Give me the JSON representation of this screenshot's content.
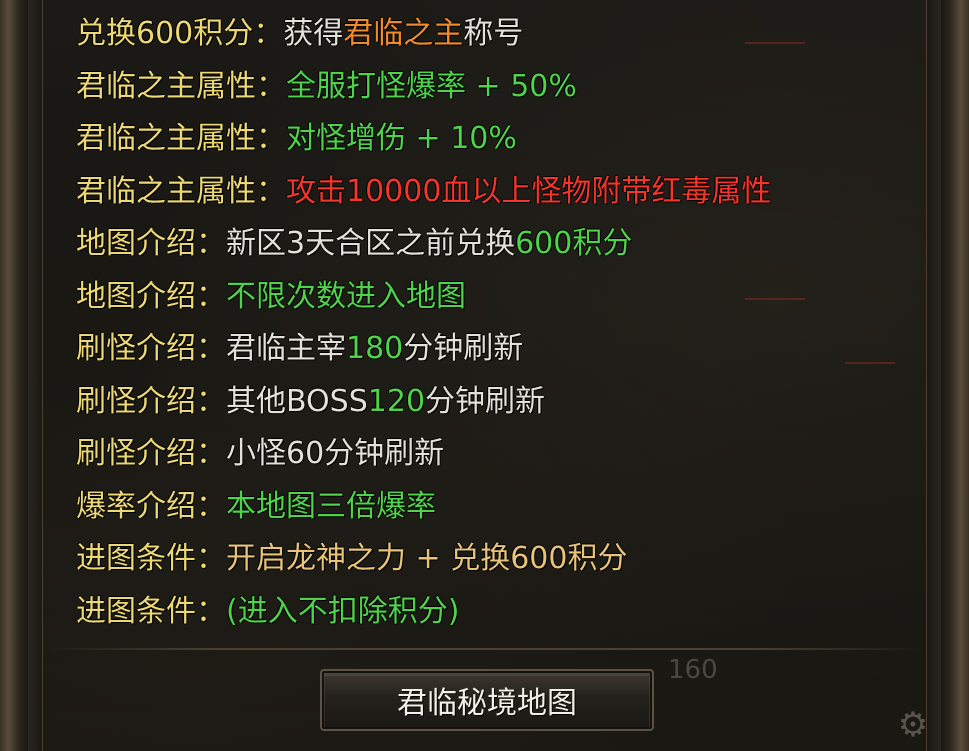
{
  "lines": [
    {
      "segments": [
        {
          "text": "兑换600积分：",
          "color": "yellow"
        },
        {
          "text": "获得",
          "color": "white"
        },
        {
          "text": "君临之主",
          "color": "orange"
        },
        {
          "text": "称号",
          "color": "white"
        }
      ]
    },
    {
      "segments": [
        {
          "text": "君临之主属性：",
          "color": "yellow"
        },
        {
          "text": "全服打怪爆率 + 50%",
          "color": "green"
        }
      ]
    },
    {
      "segments": [
        {
          "text": "君临之主属性：",
          "color": "yellow"
        },
        {
          "text": "对怪增伤 + 10%",
          "color": "green"
        }
      ]
    },
    {
      "segments": [
        {
          "text": "君临之主属性：",
          "color": "yellow"
        },
        {
          "text": "攻击10000血以上怪物附带红毒属性",
          "color": "red"
        }
      ]
    },
    {
      "segments": [
        {
          "text": "地图介绍：",
          "color": "yellow"
        },
        {
          "text": "新区3天合区之前兑换",
          "color": "white"
        },
        {
          "text": "600积分",
          "color": "green"
        }
      ]
    },
    {
      "segments": [
        {
          "text": "地图介绍：",
          "color": "yellow"
        },
        {
          "text": "不限次数进入地图",
          "color": "green"
        }
      ]
    },
    {
      "segments": [
        {
          "text": "刷怪介绍：",
          "color": "yellow"
        },
        {
          "text": "君临主宰",
          "color": "white"
        },
        {
          "text": "180",
          "color": "green"
        },
        {
          "text": "分钟刷新",
          "color": "white"
        }
      ]
    },
    {
      "segments": [
        {
          "text": "刷怪介绍：",
          "color": "yellow"
        },
        {
          "text": "其他BOSS",
          "color": "white"
        },
        {
          "text": "120",
          "color": "green"
        },
        {
          "text": "分钟刷新",
          "color": "white"
        }
      ]
    },
    {
      "segments": [
        {
          "text": "刷怪介绍：",
          "color": "yellow"
        },
        {
          "text": "小怪60分钟刷新",
          "color": "white"
        }
      ]
    },
    {
      "segments": [
        {
          "text": "爆率介绍：",
          "color": "yellow"
        },
        {
          "text": "本地图三倍爆率",
          "color": "green"
        }
      ]
    },
    {
      "segments": [
        {
          "text": "进图条件：",
          "color": "yellow"
        },
        {
          "text": "开启龙神之力 + 兑换600积分",
          "color": "tan"
        }
      ]
    },
    {
      "segments": [
        {
          "text": "进图条件：",
          "color": "yellow"
        },
        {
          "text": "(进入不扣除积分)",
          "color": "green"
        }
      ]
    }
  ],
  "button": {
    "label": "君临秘境地图"
  },
  "background_number": "160",
  "colors": {
    "yellow": "#ecd875",
    "white": "#e4e1d8",
    "orange": "#f08a2a",
    "green": "#4fd34a",
    "red": "#f3352c",
    "tan": "#e8c37a"
  },
  "icons": {
    "corner": "gear-icon"
  }
}
